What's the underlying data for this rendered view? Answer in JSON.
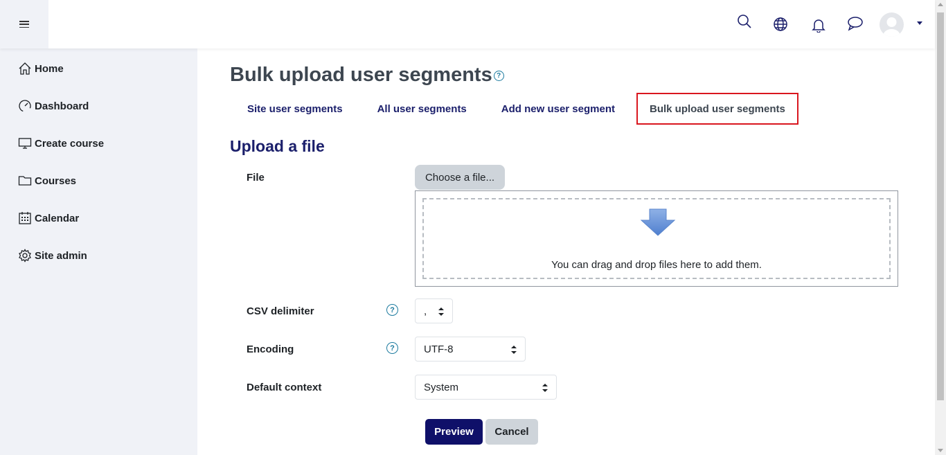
{
  "navbar": {
    "menu_icon": "hamburger-icon",
    "icons": [
      "search-icon",
      "globe-icon",
      "bell-icon",
      "chat-icon"
    ],
    "avatar_icon": "user-avatar",
    "accent": "#1b1f6b"
  },
  "sidebar": {
    "items": [
      {
        "label": "Home",
        "icon": "home-icon"
      },
      {
        "label": "Dashboard",
        "icon": "gauge-icon"
      },
      {
        "label": "Create course",
        "icon": "monitor-icon"
      },
      {
        "label": "Courses",
        "icon": "folder-icon"
      },
      {
        "label": "Calendar",
        "icon": "calendar-icon"
      },
      {
        "label": "Site admin",
        "icon": "gear-icon"
      }
    ]
  },
  "main": {
    "page_title": "Bulk upload user segments",
    "tabs": [
      {
        "label": "Site user segments",
        "active": false
      },
      {
        "label": "All user segments",
        "active": false
      },
      {
        "label": "Add new user segment",
        "active": false
      },
      {
        "label": "Bulk upload user segments",
        "active": true
      }
    ],
    "section_title": "Upload a file",
    "form": {
      "file_label": "File",
      "choose_button": "Choose a file...",
      "drop_text": "You can drag and drop files here to add them.",
      "csv_label": "CSV delimiter",
      "csv_value": ",",
      "encoding_label": "Encoding",
      "encoding_value": "UTF-8",
      "context_label": "Default context",
      "context_value": "System",
      "help_glyph": "?"
    },
    "buttons": {
      "preview": "Preview",
      "cancel": "Cancel"
    }
  },
  "colors": {
    "primary": "#0f1069",
    "link": "#1b1f6b",
    "active_tab_border": "#d9161e",
    "sidebar_bg": "#f0f2f7",
    "help": "#1b7a9e"
  }
}
